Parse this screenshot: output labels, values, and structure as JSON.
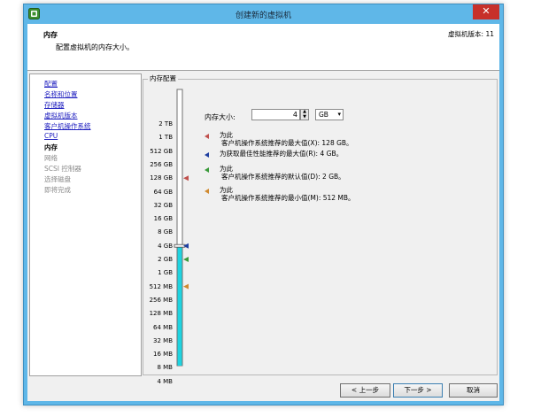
{
  "window": {
    "title": "创建新的虚拟机",
    "close_glyph": "✕"
  },
  "header": {
    "title": "内存",
    "subtitle": "配置虚拟机的内存大小。",
    "version": "虚拟机版本: 11"
  },
  "sidebar": {
    "items": [
      {
        "label": "配置",
        "state": "link"
      },
      {
        "label": "名称和位置",
        "state": "link"
      },
      {
        "label": "存储器",
        "state": "link"
      },
      {
        "label": "虚拟机版本",
        "state": "link"
      },
      {
        "label": "客户机操作系统",
        "state": "link"
      },
      {
        "label": "CPU",
        "state": "link"
      },
      {
        "label": "内存",
        "state": "current"
      },
      {
        "label": "网络",
        "state": "disabled"
      },
      {
        "label": "SCSI 控制器",
        "state": "disabled"
      },
      {
        "label": "选择磁盘",
        "state": "disabled"
      },
      {
        "label": "即将完成",
        "state": "disabled"
      }
    ]
  },
  "memory_config": {
    "group_title": "内存配置",
    "size_label": "内存大小:",
    "size_value": "4",
    "unit_options": [
      "GB"
    ],
    "unit_value": "GB",
    "scale_labels": [
      "2 TB",
      "1 TB",
      "512 GB",
      "256 GB",
      "128 GB",
      "64 GB",
      "32 GB",
      "16 GB",
      "8 GB",
      "4 GB",
      "2 GB",
      "1 GB",
      "512 MB",
      "256 MB",
      "128 MB",
      "64 MB",
      "32 MB",
      "16 MB",
      "8 MB",
      "4 MB"
    ],
    "markers": [
      {
        "heading": "为此",
        "text": "客户机操作系统推荐的最大值(X): 128 GB。",
        "color": "#c0504d",
        "scale_label": "128 GB"
      },
      {
        "heading": "",
        "text": "为获取最佳性能推荐的最大值(R): 4 GB。",
        "color": "#1f3fa0",
        "scale_label": "4 GB"
      },
      {
        "heading": "为此",
        "text": "客户机操作系统推荐的默认值(D): 2 GB。",
        "color": "#3a9a3a",
        "scale_label": "2 GB"
      },
      {
        "heading": "为此",
        "text": "客户机操作系统推荐的最小值(M): 512 MB。",
        "color": "#d08a30",
        "scale_label": "512 MB"
      }
    ]
  },
  "buttons": {
    "back": "< 上一步",
    "next": "下一步 >",
    "cancel": "取消"
  },
  "colors": {
    "titlebar": "#5fb7e8",
    "slider_fill": "#1ed3e0",
    "link": "#2020c0"
  }
}
